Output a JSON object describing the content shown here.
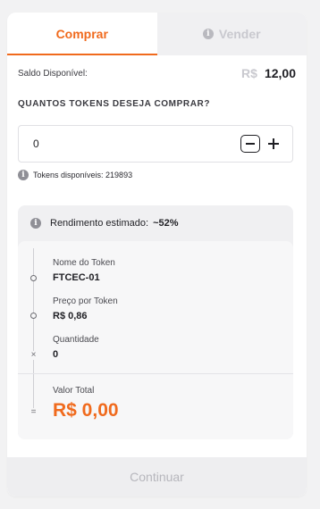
{
  "tabs": {
    "buy_label": "Comprar",
    "sell_label": "Vender"
  },
  "balance": {
    "label": "Saldo Disponível:",
    "currency": "R$",
    "amount": "12,00"
  },
  "question": "QUANTOS TOKENS DESEJA COMPRAR?",
  "quantity_input": {
    "value": "0"
  },
  "available_tokens": "Tokens disponíveis: 219893",
  "summary": {
    "yield_label": "Rendimento estimado:",
    "yield_value": "~52%",
    "token_name_label": "Nome do Token",
    "token_name_value": "FTCEC-01",
    "price_label": "Preço por Token",
    "price_value": "R$ 0,86",
    "quantity_label": "Quantidade",
    "quantity_value": "0",
    "total_label": "Valor Total",
    "total_value": "R$ 0,00"
  },
  "continue_label": "Continuar",
  "icons": {
    "info": "info-icon",
    "minus": "minus-icon",
    "plus": "plus-icon"
  },
  "colors": {
    "accent": "#f06a1d",
    "muted": "#c9c9cf"
  }
}
